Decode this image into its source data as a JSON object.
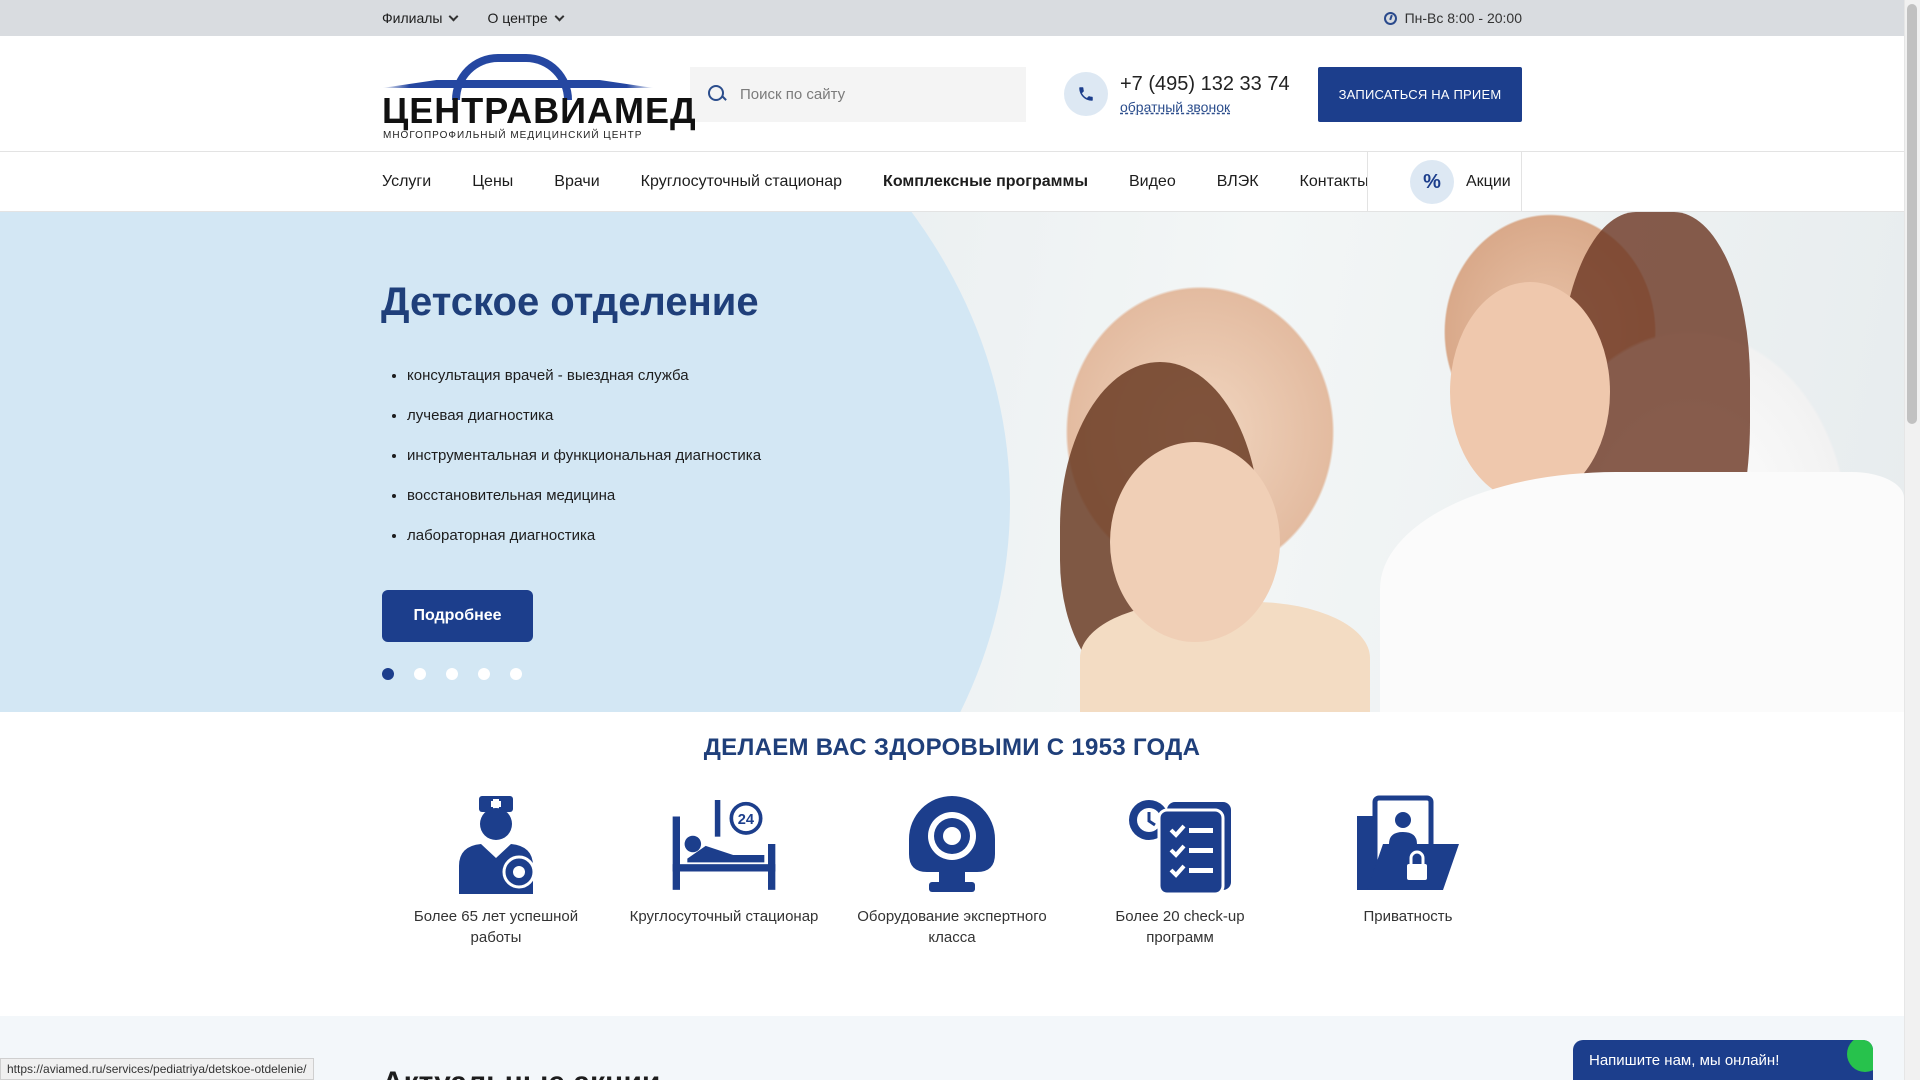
{
  "topbar": {
    "branches_label": "Филиалы",
    "about_label": "О центре",
    "hours": "Пн-Вс 8:00 - 20:00"
  },
  "header": {
    "logo_name": "ЦЕНТРАВИАМЕД",
    "logo_sub": "МНОГОПРОФИЛЬНЫЙ МЕДИЦИНСКИЙ ЦЕНТР",
    "search_placeholder": "Поиск по сайту",
    "phone": "+7 (495) 132 33 74",
    "callback": "обратный звонок",
    "appointment_button": "ЗАПИСАТЬСЯ НА ПРИЕМ"
  },
  "nav": {
    "items": [
      "Услуги",
      "Цены",
      "Врачи",
      "Круглосуточный стационар",
      "Комплексные программы",
      "Видео",
      "ВЛЭК",
      "Контакты"
    ],
    "promo_label": "Акции"
  },
  "hero": {
    "title": "Детское отделение",
    "list": [
      "консультация врачей - выездная служба",
      "лучевая диагностика",
      "инструментальная и функциональная диагностика",
      "восстановительная медицина",
      "лабораторная диагностика"
    ],
    "button": "Подробнее",
    "slides_total": 5,
    "active_slide": 1
  },
  "slogan": "ДЕЛАЕМ ВАС ЗДОРОВЫМИ С 1953 ГОДА",
  "features": [
    {
      "icon": "doctor-icon",
      "label": "Более 65 лет успешной работы"
    },
    {
      "icon": "hospital-bed-24-icon",
      "label": "Круглосуточный стационар"
    },
    {
      "icon": "mri-scanner-icon",
      "label": "Оборудование экспертного класса"
    },
    {
      "icon": "checklist-icon",
      "label": "Более 20 check-up программ"
    },
    {
      "icon": "privacy-folder-icon",
      "label": "Приватность"
    }
  ],
  "section_heading": "Актуальные акции",
  "status_url": "https://aviamed.ru/services/pediatriya/detskoe-otdelenie/",
  "chat_label": "Напишите нам, мы онлайн!",
  "colors": {
    "brand": "#1c3e8c",
    "hero_bg": "#d3e7f4",
    "topbar_bg": "#d9dce0"
  }
}
